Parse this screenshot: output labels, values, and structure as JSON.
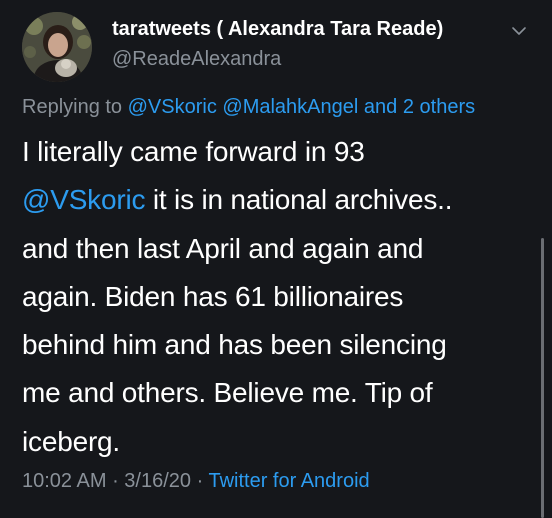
{
  "author": {
    "display_name": "taratweets ( Alexandra Tara Reade)",
    "handle": "@ReadeAlexandra"
  },
  "reply": {
    "prefix": "Replying to ",
    "mention_1": "@VSkoric",
    "mention_2": "@MalahkAngel",
    "others": "and 2 others"
  },
  "tweet": {
    "line_1": "I literally came forward in 93",
    "mention": "@VSkoric",
    "line_2_rest": " it is in national archives..",
    "line_3": "and then last April and again and",
    "line_4": "again. Biden has 61 billionaires",
    "line_5": "behind him and has been silencing",
    "line_6": "me and others. Believe me. Tip of",
    "line_7": "iceberg."
  },
  "meta": {
    "time": "10:02 AM",
    "date": "3/16/20",
    "separator": " · ",
    "source": "Twitter for Android"
  },
  "icons": {
    "avatar": "profile-photo",
    "caret": "chevron-down-icon"
  },
  "colors": {
    "background": "#15171b",
    "link": "#2c9cf0",
    "muted": "#8a9199",
    "text": "#ffffff"
  }
}
